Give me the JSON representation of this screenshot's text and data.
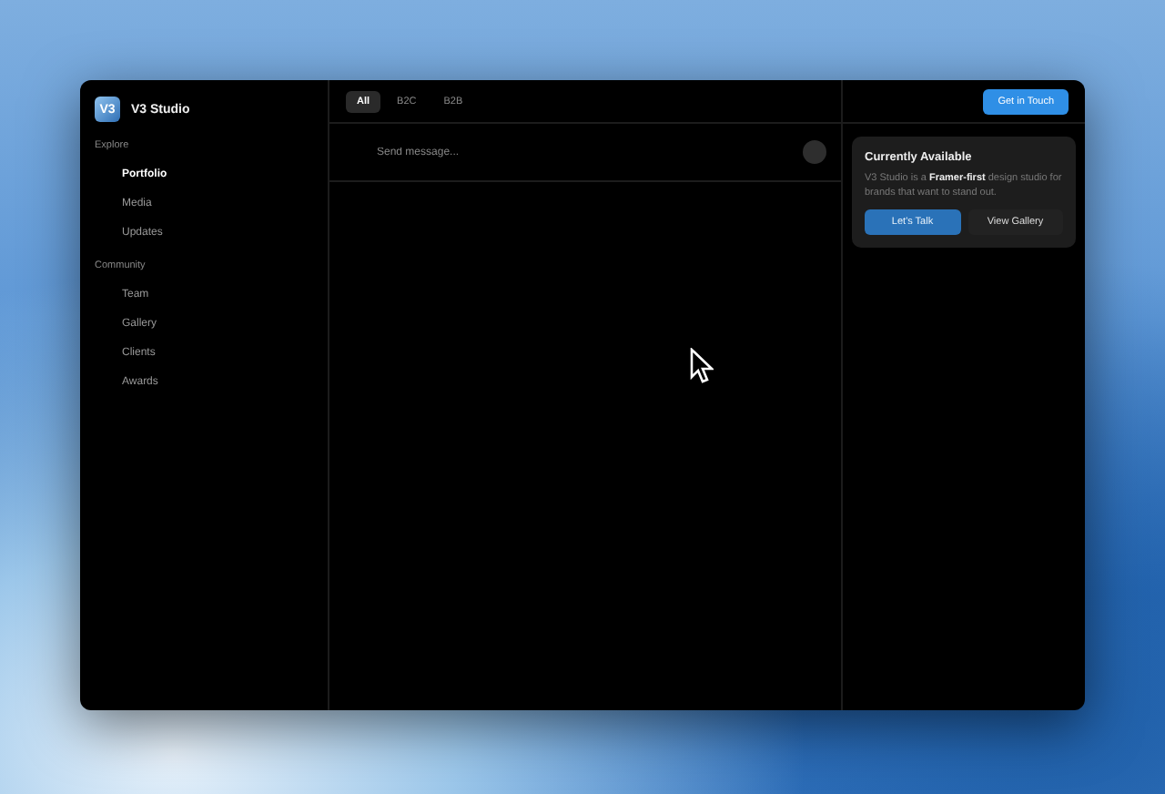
{
  "brand": {
    "logo": "V3",
    "title": "V3 Studio"
  },
  "sidebar": {
    "sections": [
      {
        "heading": "Explore",
        "items": [
          {
            "label": "Portfolio",
            "selected": true
          },
          {
            "label": "Media",
            "selected": false
          },
          {
            "label": "Updates",
            "selected": false
          }
        ]
      },
      {
        "heading": "Community",
        "items": [
          {
            "label": "Team",
            "selected": false
          },
          {
            "label": "Gallery",
            "selected": false
          },
          {
            "label": "Clients",
            "selected": false
          },
          {
            "label": "Awards",
            "selected": false
          }
        ]
      }
    ]
  },
  "tabs": [
    {
      "label": "All",
      "selected": true
    },
    {
      "label": "B2C",
      "selected": false
    },
    {
      "label": "B2B",
      "selected": false
    }
  ],
  "composer": {
    "placeholder": "Send message..."
  },
  "header_button": "Get in Touch",
  "card": {
    "title": "Currently Available",
    "text": "V3 Studio is a **Framer-first** design studio for brands that want to stand out.",
    "buttons": [
      {
        "label": "Let's Talk",
        "kind": "primary"
      },
      {
        "label": "View Gallery",
        "kind": "secondary"
      }
    ]
  }
}
